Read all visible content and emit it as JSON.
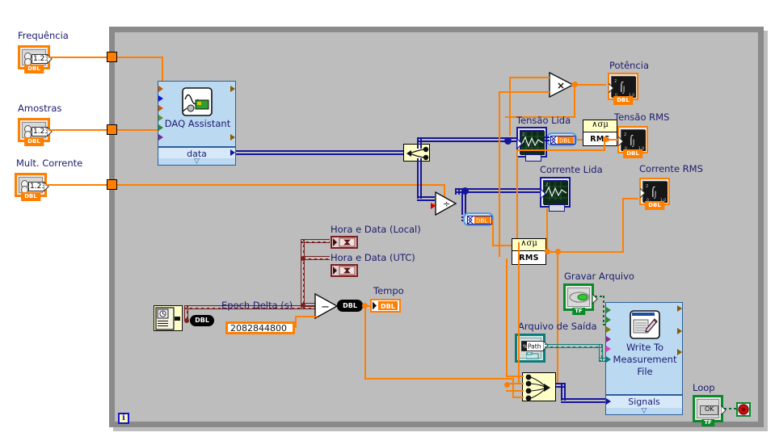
{
  "app": {
    "type": "labview-block-diagram",
    "structure": "while-loop",
    "iteration_terminal": "i"
  },
  "colors": {
    "wire_double": "#ff7f00",
    "wire_dynamic": "#16169b",
    "wire_timestamp": "#7b1f1f",
    "wire_boolean": "#0b6b2a",
    "wire_path": "#0e7b7b",
    "loop_border": "#8a8a8a",
    "express_fill": "#bcd9f2",
    "label_text": "#1b1b6e",
    "node_fill": "#ffffc8"
  },
  "controls": [
    {
      "name": "frequencia",
      "label": "Frequência",
      "datatype": "DBL",
      "display": "1.23",
      "kind": "numeric-control"
    },
    {
      "name": "amostras",
      "label": "Amostras",
      "datatype": "DBL",
      "display": "1.23",
      "kind": "numeric-control"
    },
    {
      "name": "mult-corrente",
      "label": "Mult. Corrente",
      "datatype": "DBL",
      "display": "1.23",
      "kind": "numeric-control"
    },
    {
      "name": "gravar-arquivo",
      "label": "Gravar Arquivo",
      "datatype": "TF",
      "display": "",
      "kind": "boolean-control"
    },
    {
      "name": "arquivo-saida",
      "label": "Arquivo de Saída",
      "datatype": "Path",
      "display": "Path",
      "kind": "path-control"
    },
    {
      "name": "loop",
      "label": "Loop",
      "datatype": "TF",
      "display": "OK",
      "kind": "boolean-control"
    }
  ],
  "indicators": [
    {
      "name": "potencia",
      "label": "Potência",
      "datatype": "DBL",
      "kind": "numeric-indicator"
    },
    {
      "name": "tensao-lida",
      "label": "Tensão Lida",
      "datatype": "",
      "kind": "waveform-graph"
    },
    {
      "name": "tensao-rms",
      "label": "Tensão RMS",
      "datatype": "DBL",
      "kind": "numeric-indicator"
    },
    {
      "name": "corrente-lida",
      "label": "Corrente Lida",
      "datatype": "",
      "kind": "waveform-graph"
    },
    {
      "name": "corrente-rms",
      "label": "Corrente RMS",
      "datatype": "DBL",
      "kind": "numeric-indicator"
    },
    {
      "name": "hora-data-local",
      "label": "Hora e Data (Local)",
      "datatype": "timestamp",
      "kind": "timestamp-indicator"
    },
    {
      "name": "hora-data-utc",
      "label": "Hora e Data (UTC)",
      "datatype": "timestamp",
      "kind": "timestamp-indicator"
    },
    {
      "name": "tempo",
      "label": "Tempo",
      "datatype": "DBL",
      "kind": "numeric-indicator"
    }
  ],
  "express_vis": [
    {
      "name": "daq-assistant",
      "title": "DAQ Assistant",
      "output_label": "data",
      "expand_glyph": "▽"
    },
    {
      "name": "write-to-measurement-file",
      "title_line1": "Write To",
      "title_line2": "Measurement",
      "title_line3": "File",
      "input_label": "Signals",
      "expand_glyph": "▽"
    }
  ],
  "nodes": [
    {
      "name": "multiply",
      "symbol": "×",
      "kind": "arithmetic"
    },
    {
      "name": "divide",
      "symbol": "÷",
      "kind": "arithmetic"
    },
    {
      "name": "subtract",
      "symbol": "−",
      "kind": "arithmetic"
    },
    {
      "name": "rms-tensao",
      "top": "∧σμ",
      "label": "RMS",
      "kind": "express-statistics"
    },
    {
      "name": "rms-corrente",
      "top": "∧σμ",
      "label": "RMS",
      "kind": "express-statistics"
    },
    {
      "name": "split-signals",
      "label": "",
      "kind": "split-signals"
    },
    {
      "name": "merge-signals",
      "label": "",
      "kind": "merge-signals"
    },
    {
      "name": "to-dbl-tensao",
      "label": "DBL",
      "kind": "convert-from-dynamic"
    },
    {
      "name": "to-dbl-corrente",
      "label": "DBL",
      "kind": "convert-from-dynamic"
    },
    {
      "name": "get-date-time",
      "label": "DBL",
      "kind": "get-date-time-in-seconds"
    },
    {
      "name": "to-double-tempo",
      "label": "DBL",
      "kind": "to-double-precision"
    }
  ],
  "constants": [
    {
      "name": "epoch-delta",
      "label": "Epoch Delta (s)",
      "value": "2082844800",
      "datatype": "DBL"
    }
  ],
  "stop_button": {
    "name": "stop",
    "label": ""
  }
}
